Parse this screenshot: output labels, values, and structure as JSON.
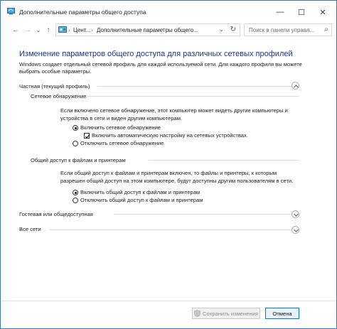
{
  "window": {
    "title": "Дополнительные параметры общего доступа",
    "minimize": "—",
    "maximize": "☐",
    "close": "✕"
  },
  "nav": {
    "back": "←",
    "forward": "→",
    "dropdown": "⌄",
    "up": "↑",
    "breadcrumb": [
      "Цент...",
      "Дополнительные параметры общего..."
    ],
    "separator": "›",
    "addr_dropdown": "⌄",
    "refresh": "↻",
    "search_placeholder": "Поиск в панели управл...",
    "search_icon": "⌕"
  },
  "main": {
    "heading": "Изменение параметров общего доступа для различных сетевых профилей",
    "description": "Windows создает отдельный сетевой профиль для каждой используемой сети. Для каждого профиля вы можете выбрать особые параметры.",
    "private": {
      "title": "Частная (текущий профиль)",
      "discovery": {
        "title": "Сетевое обнаружение",
        "text": "Если включено сетевое обнаружение, этот компьютер может видеть другие компьютеры и устройства в сети и виден другим компьютерам.",
        "on": "Включить сетевое обнаружение",
        "auto": "Включить автоматическую настройку на сетевых устройствах.",
        "off": "Отключить сетевое обнаружение"
      },
      "sharing": {
        "title": "Общий доступ к файлам и принтерам",
        "text": "Если общий доступ к файлам и принтерам включен, то файлы и принтеры, к которым разрешен общий доступ на этом компьютере, будут доступны другим пользователям в сети.",
        "on": "Включить общий доступ к файлам и принтерам",
        "off": "Отключить общий доступ к файлам и принтерам"
      }
    },
    "guest": {
      "title": "Гостевая или общедоступная"
    },
    "all": {
      "title": "Все сети"
    }
  },
  "footer": {
    "save": "Сохранить изменения",
    "cancel": "Отмена"
  },
  "colors": {
    "heading": "#1e3287",
    "accent": "#0078d7",
    "window_border": "#3c78b4"
  }
}
